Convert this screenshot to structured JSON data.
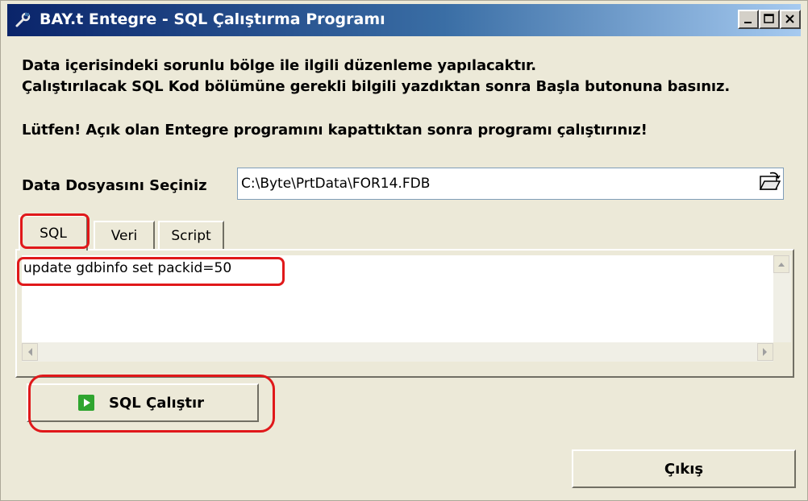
{
  "window": {
    "title": "BAY.t Entegre - SQL Çalıştırma Programı",
    "title_icon": "wrench-icon",
    "buttons": {
      "minimize": "minimize-icon",
      "maximize": "maximize-icon",
      "close": "close-icon"
    }
  },
  "messages": {
    "line1": "Data içerisindeki sorunlu bölge ile ilgili düzenleme yapılacaktır.",
    "line2": "Çalıştırılacak SQL Kod bölümüne gerekli bilgili yazdıktan sonra Başla butonuna basınız.",
    "line3": "Lütfen! Açık olan Entegre programını kapattıktan sonra programı çalıştırınız!"
  },
  "file": {
    "label": "Data Dosyasını Seçiniz",
    "value": "C:\\Byte\\PrtData\\FOR14.FDB",
    "browse_icon": "open-folder-icon"
  },
  "tabs": [
    {
      "label": "SQL",
      "active": true
    },
    {
      "label": "Veri",
      "active": false
    },
    {
      "label": "Script",
      "active": false
    }
  ],
  "editor": {
    "value": "update gdbinfo set packid=50"
  },
  "run_button": {
    "label": "SQL Çalıştır",
    "icon": "play-icon"
  },
  "exit_button": {
    "label": "Çıkış"
  },
  "colors": {
    "highlight": "#e0181a",
    "titlebar_start": "#0a246a",
    "titlebar_end": "#a6caf0",
    "face": "#ece9d8"
  }
}
